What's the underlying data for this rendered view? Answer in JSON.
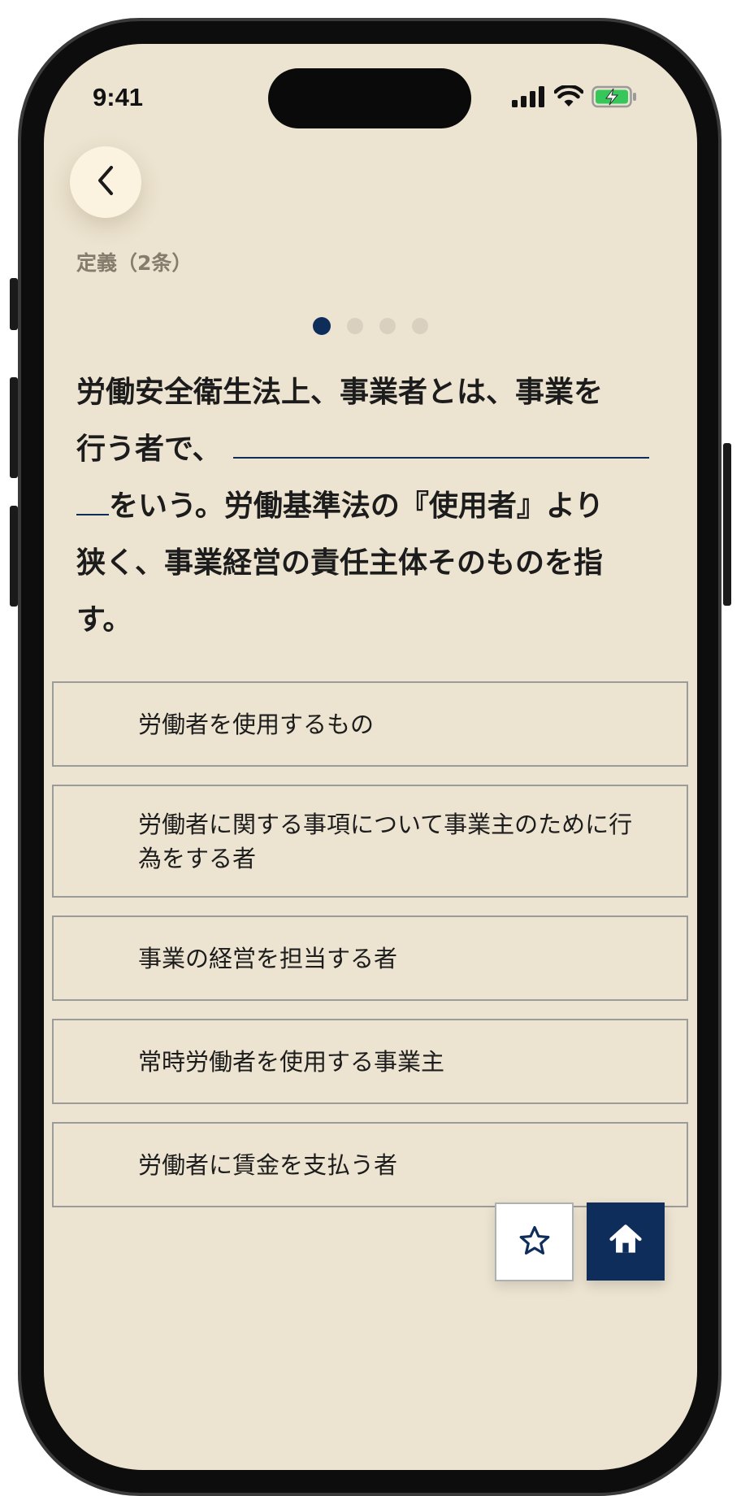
{
  "status_bar": {
    "time": "9:41",
    "icons": [
      "signal-icon",
      "wifi-icon",
      "battery-charging-icon"
    ]
  },
  "nav": {
    "back_icon": "chevron-left-icon"
  },
  "section": {
    "label": "定義（2条）"
  },
  "pagination": {
    "total": 4,
    "active_index": 0
  },
  "question": {
    "line1": "労働安全衛生法上、事業者とは、事業を",
    "line2_prefix": "行う者で、",
    "line3_suffix": "をいう。労働基準法の『使用者』より",
    "line4": "狭く、事業経営の責任主体そのものを指",
    "line5": "す。"
  },
  "options": [
    {
      "label": "労働者を使用するもの"
    },
    {
      "label": "労働者に関する事項について事業主のために行為をする者"
    },
    {
      "label": "事業の経営を担当する者"
    },
    {
      "label": "常時労働者を使用する事業主"
    },
    {
      "label": "労働者に賃金を支払う者"
    }
  ],
  "actions": {
    "favorite_icon": "star-icon",
    "home_icon": "home-icon"
  },
  "colors": {
    "background": "#ece3d0",
    "accent": "#0e2d5a",
    "option_border": "#9b9c9a",
    "label_gray": "#857c6e"
  }
}
